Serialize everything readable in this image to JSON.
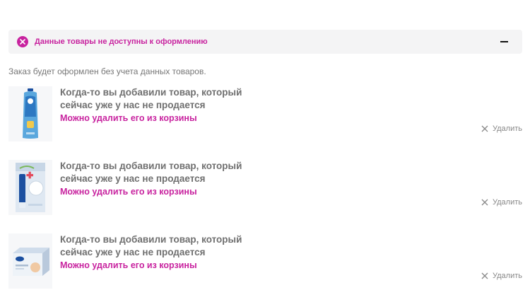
{
  "banner": {
    "title": "Данные товары не доступны к оформлению",
    "status_icon": "close-circle-icon",
    "collapse_icon": "minus-icon"
  },
  "note": "Заказ будет оформлен без учета данных товаров.",
  "items": [
    {
      "title": "Когда-то вы добавили товар,  который сейчас уже у нас не продается",
      "hint": "Можно удалить его из корзины",
      "remove_label": "Удалить",
      "image": "sunscreen-bottle-image"
    },
    {
      "title": "Когда-то вы добавили товар,  который сейчас уже у нас не продается",
      "hint": "Можно удалить его из корзины",
      "remove_label": "Удалить",
      "image": "lip-balm-box-image"
    },
    {
      "title": "Когда-то вы добавили товар,  который сейчас уже у нас не продается",
      "hint": "Можно удалить его из корзины",
      "remove_label": "Удалить",
      "image": "cream-box-image"
    }
  ],
  "colors": {
    "accent": "#c8239f",
    "banner_bg": "#f4f4f5",
    "muted_text": "#777777"
  }
}
